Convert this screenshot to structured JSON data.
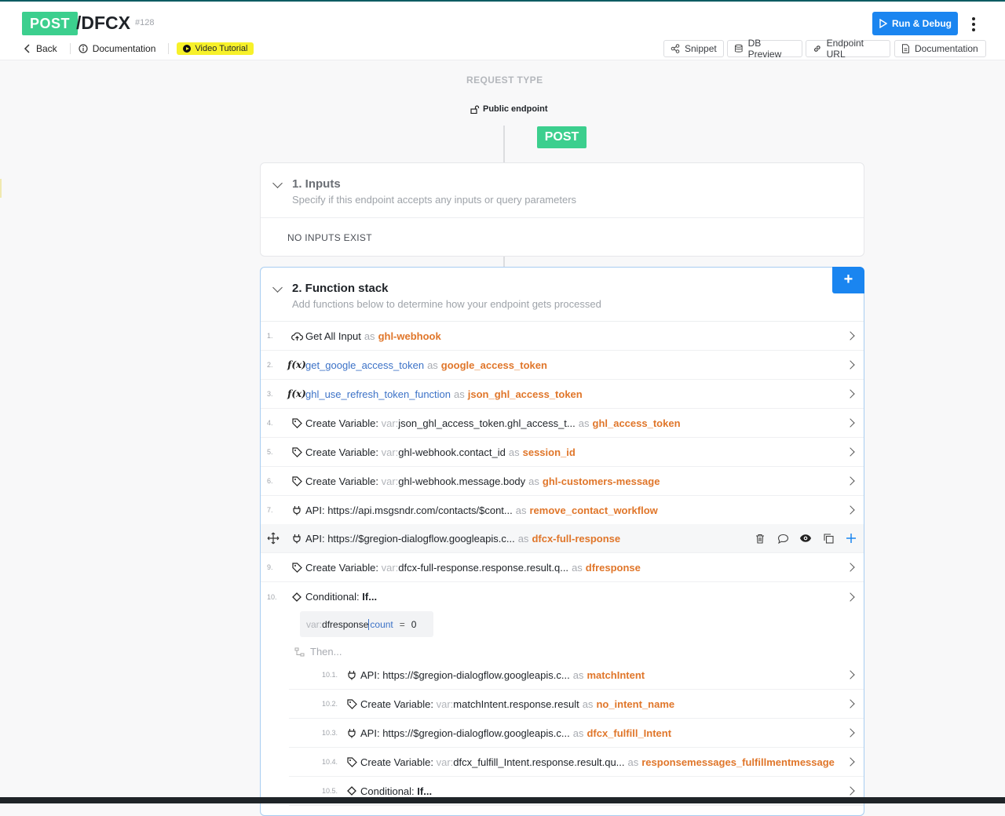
{
  "header": {
    "method": "POST",
    "path": "/DFCX",
    "id": "#128",
    "back_label": "Back",
    "documentation_label": "Documentation",
    "video_label": "Video Tutorial",
    "run_label": "Run & Debug",
    "tools": {
      "snippet": "Snippet",
      "db_preview": "DB Preview",
      "endpoint_url": "Endpoint URL",
      "documentation": "Documentation"
    }
  },
  "request": {
    "label": "REQUEST TYPE",
    "visibility": "Public endpoint",
    "method": "POST"
  },
  "inputs": {
    "title": "1. Inputs",
    "subtitle": "Specify if this endpoint accepts any inputs or query parameters",
    "empty": "NO INPUTS EXIST"
  },
  "fstack": {
    "title": "2. Function stack",
    "subtitle": "Add functions below to determine how your endpoint gets processed",
    "add_symbol": "+",
    "as_word": "as",
    "var_prefix": "var:",
    "rows": [
      {
        "num": "1.",
        "icon": "cloud-input-icon",
        "label": "Get All Input",
        "value": "",
        "output": "ghl-webhook"
      },
      {
        "num": "2.",
        "icon": "function-icon",
        "label": "",
        "fn": "get_google_access_token",
        "output": "google_access_token"
      },
      {
        "num": "3.",
        "icon": "function-icon",
        "label": "",
        "fn": "ghl_use_refresh_token_function",
        "output": "json_ghl_access_token"
      },
      {
        "num": "4.",
        "icon": "tag-icon",
        "label": "Create Variable:",
        "value": "json_ghl_access_token.ghl_access_t...",
        "output": "ghl_access_token"
      },
      {
        "num": "5.",
        "icon": "tag-icon",
        "label": "Create Variable:",
        "value": "ghl-webhook.contact_id",
        "output": "session_id"
      },
      {
        "num": "6.",
        "icon": "tag-icon",
        "label": "Create Variable:",
        "value": "ghl-webhook.message.body",
        "output": "ghl-customers-message"
      },
      {
        "num": "7.",
        "icon": "plug-icon",
        "label": "API:",
        "value": "https://api.msgsndr.com/contacts/$cont...",
        "output": "remove_contact_workflow"
      },
      {
        "num": "",
        "icon": "plug-icon",
        "label": "API:",
        "value": "https://$gregion-dialogflow.googleapis.c...",
        "output": "dfcx-full-response"
      },
      {
        "num": "9.",
        "icon": "tag-icon",
        "label": "Create Variable:",
        "value": "dfcx-full-response.response.result.q...",
        "output": "dfresponse"
      },
      {
        "num": "10.",
        "icon": "diamond-icon",
        "label": "Conditional:",
        "value": "If...",
        "output": ""
      }
    ],
    "condition": {
      "var": "var:",
      "name": "dfresponse",
      "filter": "count",
      "op": "=",
      "value": "0"
    },
    "then_label": "Then...",
    "sub_rows": [
      {
        "num": "10.1.",
        "icon": "plug-icon",
        "label": "API:",
        "value": "https://$gregion-dialogflow.googleapis.c...",
        "output": "matchIntent"
      },
      {
        "num": "10.2.",
        "icon": "tag-icon",
        "label": "Create Variable:",
        "value": "matchIntent.response.result",
        "output": "no_intent_name"
      },
      {
        "num": "10.3.",
        "icon": "plug-icon",
        "label": "API:",
        "value": "https://$gregion-dialogflow.googleapis.c...",
        "output": "dfcx_fulfill_Intent"
      },
      {
        "num": "10.4.",
        "icon": "tag-icon",
        "label": "Create Variable:",
        "value": "dfcx_fulfill_Intent.response.result.qu...",
        "output": "responsemessages_fulfillmentmessage"
      },
      {
        "num": "10.5.",
        "icon": "diamond-icon",
        "label": "Conditional:",
        "value": "If...",
        "output": ""
      }
    ]
  },
  "colors": {
    "accent": "#1a85f0",
    "method": "#3ccf8e",
    "output": "#e0762a",
    "function": "#3c72c7"
  }
}
